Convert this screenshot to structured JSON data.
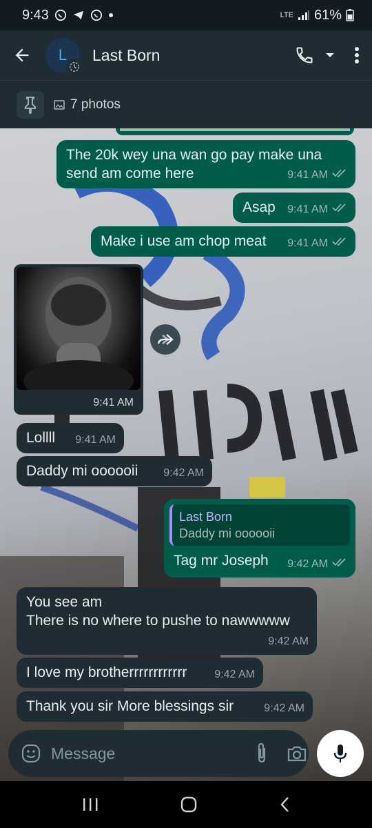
{
  "status_bar": {
    "time": "9:43",
    "network": "LTE",
    "battery": "61%"
  },
  "header": {
    "avatar_letter": "L",
    "contact_name": "Last Born"
  },
  "pinned": {
    "label": "7 photos"
  },
  "messages": [
    {
      "type": "outgoing",
      "text": "The 20k wey una wan go pay make una send am come here",
      "time": "9:41 AM"
    },
    {
      "type": "outgoing",
      "text": "Asap",
      "time": "9:41 AM"
    },
    {
      "type": "outgoing",
      "text": "Make i use am chop meat",
      "time": "9:41 AM"
    },
    {
      "type": "incoming-image",
      "time": "9:41 AM"
    },
    {
      "type": "incoming",
      "text": "Lollll",
      "time": "9:41 AM"
    },
    {
      "type": "incoming",
      "text": "Daddy mi oooooii",
      "time": "9:42 AM"
    },
    {
      "type": "outgoing-reply",
      "quote_name": "Last Born",
      "quote_text": "Daddy mi oooooii",
      "text": "Tag mr Joseph",
      "time": "9:42 AM"
    },
    {
      "type": "incoming",
      "text_lines": [
        "You see am",
        "There is no where to pushe to nawwwww"
      ],
      "time": "9:42 AM"
    },
    {
      "type": "incoming",
      "text": "I love my brotherrrrrrrrrrrr",
      "time": "9:42 AM"
    },
    {
      "type": "incoming",
      "text": "Thank you sir More blessings sir",
      "time": "9:42 AM"
    }
  ],
  "composer": {
    "placeholder": "Message"
  },
  "colors": {
    "outgoing_bubble": "#005c4b",
    "incoming_bubble": "#202c33",
    "header": "#1f2c34",
    "tick_read": "#9fb8b2"
  },
  "icons": [
    "back-arrow-icon",
    "phone-icon",
    "dropdown-icon",
    "more-vert-icon",
    "pin-icon",
    "image-icon",
    "forward-icon",
    "emoji-icon",
    "attach-icon",
    "camera-icon",
    "mic-icon",
    "recents-icon",
    "home-icon",
    "back-icon"
  ]
}
